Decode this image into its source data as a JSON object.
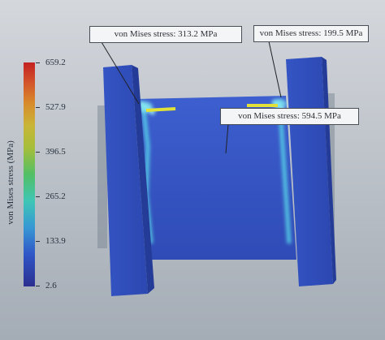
{
  "colorbar": {
    "title": "von Mises stress (MPa)",
    "ticks": [
      "659.2",
      "527.9",
      "396.5",
      "265.2",
      "133.9",
      "2.6"
    ]
  },
  "callouts": [
    {
      "label": "von Mises stress: 313.2 MPa"
    },
    {
      "label": "von Mises stress: 199.5 MPa"
    },
    {
      "label": "von Mises stress: 594.5 MPa"
    }
  ]
}
